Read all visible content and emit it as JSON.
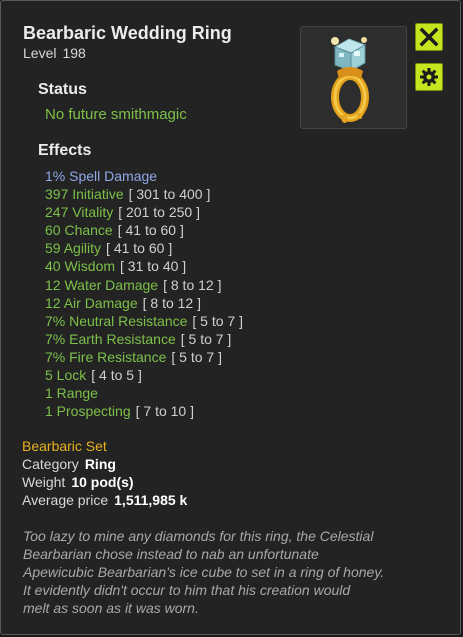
{
  "item": {
    "name": "Bearbaric Wedding Ring",
    "level_label": "Level",
    "level_value": "198",
    "image_icon": "honey-ring-with-ice-cube-icon"
  },
  "buttons": {
    "close_icon": "close-x-icon",
    "settings_icon": "gear-icon"
  },
  "colors": {
    "effect_green": "#7cc04a",
    "spell_blue": "#8fa8e6",
    "set_gold": "#e6b21f",
    "button_lime": "#c6e51e"
  },
  "status": {
    "heading": "Status",
    "text": "No future smithmagic"
  },
  "effects": {
    "heading": "Effects",
    "list": [
      {
        "text": "1% Spell Damage",
        "range": ""
      },
      {
        "text": "397 Initiative",
        "range": "[ 301 to 400 ]"
      },
      {
        "text": "247 Vitality",
        "range": "[ 201 to 250 ]"
      },
      {
        "text": "60 Chance",
        "range": "[ 41 to 60 ]"
      },
      {
        "text": "59 Agility",
        "range": "[ 41 to 60 ]"
      },
      {
        "text": "40 Wisdom",
        "range": "[ 31 to 40 ]"
      },
      {
        "text": "12 Water Damage",
        "range": "[ 8 to 12 ]"
      },
      {
        "text": "12 Air Damage",
        "range": "[ 8 to 12 ]"
      },
      {
        "text": "7% Neutral Resistance",
        "range": "[ 5 to 7 ]"
      },
      {
        "text": "7% Earth Resistance",
        "range": "[ 5 to 7 ]"
      },
      {
        "text": "7% Fire Resistance",
        "range": "[ 5 to 7 ]"
      },
      {
        "text": "5 Lock",
        "range": "[ 4 to 5 ]"
      },
      {
        "text": "1 Range",
        "range": ""
      },
      {
        "text": "1 Prospecting",
        "range": "[ 7 to 10 ]"
      }
    ]
  },
  "details": {
    "set_name": "Bearbaric Set",
    "category_label": "Category",
    "category_value": "Ring",
    "weight_label": "Weight",
    "weight_value": "10 pod(s)",
    "price_label": "Average price",
    "price_value": "1,511,985 k"
  },
  "description": [
    "Too lazy to mine any diamonds for this ring, the Celestial",
    "Bearbarian chose instead to nab an unfortunate",
    "Apewicubic Bearbarian's ice cube to set in a ring of honey.",
    "It evidently didn't occur to him that his creation would",
    "melt as soon as it was worn."
  ]
}
